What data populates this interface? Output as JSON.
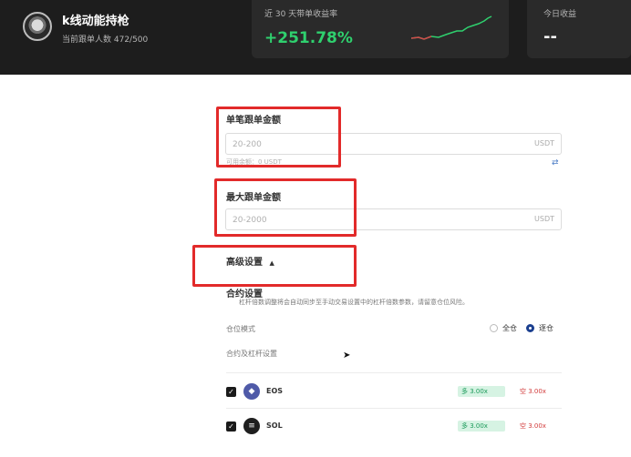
{
  "header": {
    "trader_name": "k线动能持枪",
    "followers": "当前跟单人数 472/500",
    "roi_label": "近 30 天带单收益率",
    "roi_value": "+251.78%",
    "today_label": "今日收益",
    "today_value": "--",
    "roi_color": "#2fd06e"
  },
  "form": {
    "single_label": "单笔跟单金额",
    "single_placeholder": "20-200",
    "single_unit": "USDT",
    "single_hint": "可用余额：0 USDT",
    "max_label": "最大跟单金额",
    "max_placeholder": "20-2000",
    "max_unit": "USDT",
    "advanced_label": "高级设置",
    "advanced_arrow": "▲",
    "contract_title": "合约设置",
    "contract_desc": "杠杆倍数调整将会自动同步至手动交易设置中的杠杆倍数参数，请留意仓位风险。",
    "position_mode_label": "仓位模式",
    "mode_cross": "全仓",
    "mode_isolated": "逐仓",
    "mode_selected": "逐仓",
    "leverage_section_label": "合约及杠杆设置"
  },
  "contracts": [
    {
      "symbol": "EOS",
      "icon": "eos-icon",
      "checked": true,
      "long": "多 3.00x",
      "short": "空 3.00x"
    },
    {
      "symbol": "SOL",
      "icon": "sol-icon",
      "checked": true,
      "long": "多 3.00x",
      "short": "空 3.00x"
    }
  ],
  "colors": {
    "highlight": "#e22a2a",
    "accent": "#1b3f8f",
    "long": "#1b9a5a",
    "short": "#d23b3b"
  }
}
